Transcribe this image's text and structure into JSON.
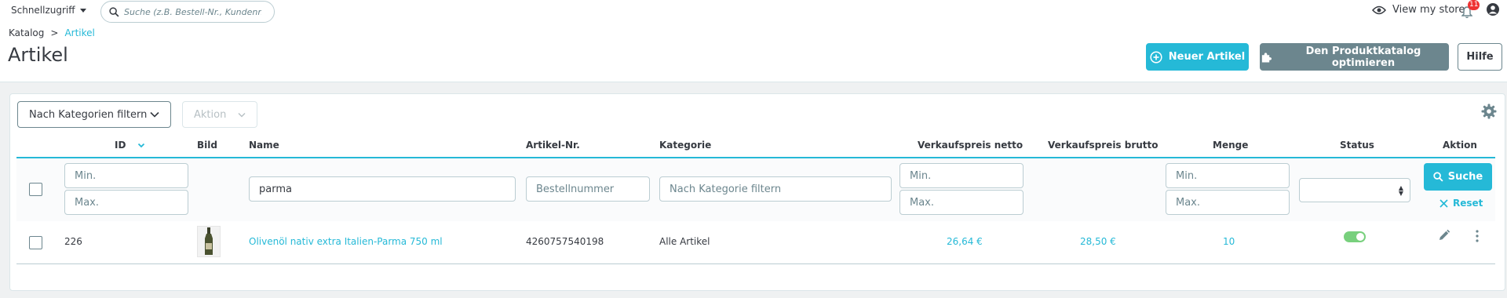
{
  "topbar": {
    "quick_access": "Schnellzugriff",
    "search_placeholder": "Suche (z.B. Bestell-Nr., Kundenname ...",
    "view_store": "View my store",
    "notification_count": "11"
  },
  "header": {
    "breadcrumb": [
      "Katalog",
      ">",
      "Artikel"
    ],
    "title": "Artikel",
    "buttons": {
      "new": "Neuer Artikel",
      "optimize": "Den Produktkatalog optimieren",
      "help": "Hilfe"
    }
  },
  "toolbar": {
    "category_filter": "Nach Kategorien filtern",
    "bulk_action": "Aktion"
  },
  "table": {
    "columns": [
      "ID",
      "Bild",
      "Name",
      "Artikel-Nr.",
      "Kategorie",
      "Verkaufspreis netto",
      "Verkaufspreis brutto",
      "Menge",
      "Status",
      "Aktion"
    ],
    "filters": {
      "id_min": "Min.",
      "id_max": "Max.",
      "name_value": "parma",
      "reference_placeholder": "Bestellnummer",
      "category_placeholder": "Nach Kategorie filtern",
      "price_min": "Min.",
      "price_max": "Max.",
      "qty_min": "Min.",
      "qty_max": "Max.",
      "search_label": "Suche",
      "reset_label": "Reset"
    },
    "rows": [
      {
        "id": "226",
        "name": "Olivenöl nativ extra Italien-Parma 750 ml",
        "reference": "4260757540198",
        "category": "Alle Artikel",
        "price_net": "26,64 €",
        "price_gross": "28,50 €",
        "quantity": "10",
        "status_enabled": true
      }
    ]
  },
  "colors": {
    "accent": "#25b9d7",
    "secondary": "#6c868e",
    "success": "#78d07d"
  },
  "icons": [
    "search-icon",
    "eye-icon",
    "bell-icon",
    "user-icon",
    "plus-circle-icon",
    "puzzle-icon",
    "chevron-down-icon",
    "gear-icon",
    "sort-icon",
    "close-icon",
    "pencil-icon",
    "kebab-icon"
  ]
}
